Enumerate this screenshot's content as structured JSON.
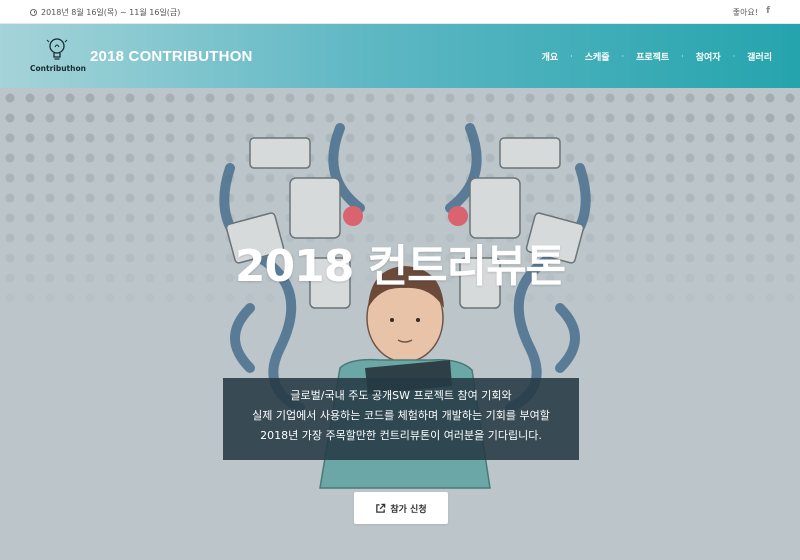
{
  "topbar": {
    "date_icon": "clock-icon",
    "date_text": "2018년 8월 16일(목) ~ 11월 16일(금)",
    "like_text": "좋아요!",
    "social_icon": "facebook-icon",
    "social_glyph": "f"
  },
  "header": {
    "logo_text": "Contributhon",
    "logo_icon": "lightbulb-icon",
    "brand": "2018 CONTRIBUTHON",
    "nav": [
      "개요",
      "스케줄",
      "프로젝트",
      "참여자",
      "갤러리"
    ],
    "gradient": [
      "#a5d4d9",
      "#25a4ad"
    ]
  },
  "hero": {
    "title": "2018 컨트리뷰톤",
    "description": [
      "글로벌/국내 주도 공개SW 프로젝트 참여 기회와",
      "실제 기업에서 사용하는 코드를 체험하며 개발하는 기회를 부여할",
      "2018년 가장 주목할만한 컨트리뷰톤이 여러분을 기다립니다."
    ],
    "apply_label": "참가 신청",
    "apply_icon": "external-link-icon"
  }
}
